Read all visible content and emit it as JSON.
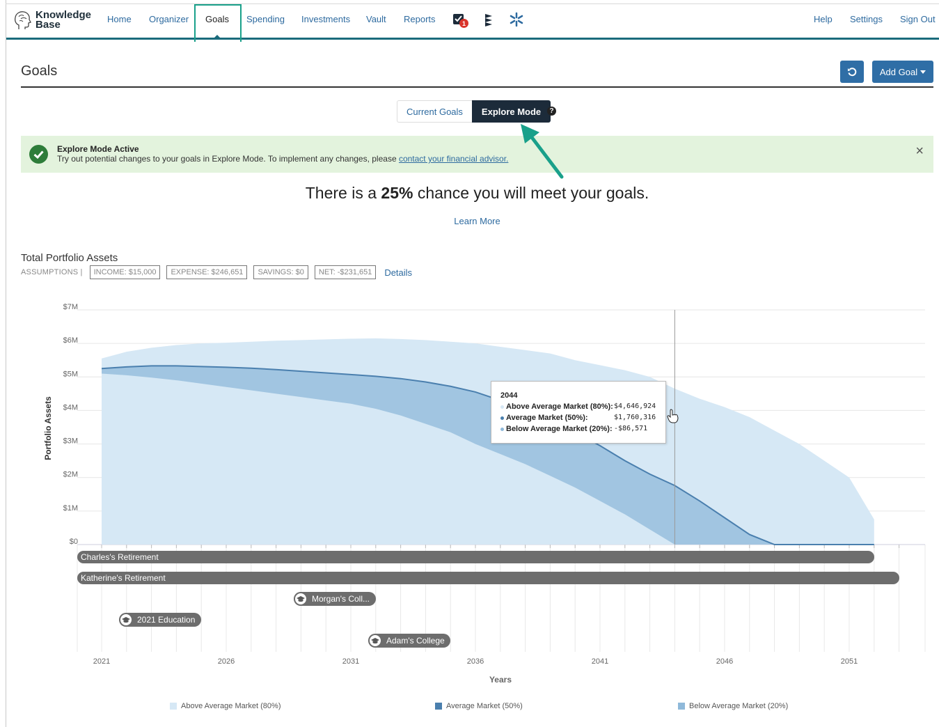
{
  "nav": {
    "brand_line1": "Knowledge",
    "brand_line2": "Base",
    "links": [
      "Home",
      "Organizer",
      "Goals",
      "Spending",
      "Investments",
      "Vault",
      "Reports"
    ],
    "right_links": [
      "Help",
      "Settings",
      "Sign Out"
    ],
    "notification_count": "1",
    "accent_color": "#1a6b7c",
    "active_color": "#19a08a"
  },
  "header": {
    "title": "Goals",
    "add_goal_label": "Add Goal"
  },
  "toggle": {
    "current_goals": "Current Goals",
    "explore_mode": "Explore Mode",
    "help": "?"
  },
  "alert": {
    "title": "Explore Mode Active",
    "text": "Try out potential changes to your goals in Explore Mode. To implement any changes, please ",
    "link": "contact your financial advisor.",
    "close": "×"
  },
  "chance": {
    "prefix": "There is a ",
    "percent": "25%",
    "suffix": " chance you will meet your goals."
  },
  "learn_more": "Learn More",
  "portfolio": {
    "title": "Total Portfolio Assets",
    "assumptions_label": "ASSUMPTIONS |",
    "income": "INCOME: $15,000",
    "expense": "EXPENSE: $246,651",
    "savings": "SAVINGS: $0",
    "net": "NET: -$231,651",
    "details": "Details"
  },
  "tooltip": {
    "year": "2044",
    "rows": [
      {
        "name": "Above Average Market (80%):",
        "value": "$4,646,924"
      },
      {
        "name": "Average Market (50%):",
        "value": "$1,760,316"
      },
      {
        "name": "Below Average Market (20%):",
        "value": "-$86,571"
      }
    ]
  },
  "goals": {
    "charles": "Charles's Retirement",
    "katherine": "Katherine's Retirement",
    "morgan": "Morgan's Coll...",
    "education": "2021 Education",
    "adam": "Adam's College"
  },
  "legend": {
    "above": "Above Average Market (80%)",
    "avg": "Average Market (50%)",
    "below": "Below Average Market (20%)"
  },
  "chart_data": {
    "type": "area",
    "title": "",
    "xlabel": "Years",
    "ylabel": "Portfolio Assets",
    "ylim": [
      0,
      7000000
    ],
    "xlim": [
      2021,
      2053
    ],
    "y_tick_labels": [
      "$0",
      "$1M",
      "$2M",
      "$3M",
      "$4M",
      "$5M",
      "$6M",
      "$7M"
    ],
    "y_ticks": [
      0,
      1000000,
      2000000,
      3000000,
      4000000,
      5000000,
      6000000,
      7000000
    ],
    "x_tick_labels": [
      "2021",
      "2026",
      "2031",
      "2036",
      "2041",
      "2046",
      "2051"
    ],
    "x_ticks": [
      2021,
      2026,
      2031,
      2036,
      2041,
      2046,
      2051
    ],
    "x": [
      2021,
      2022,
      2023,
      2024,
      2025,
      2026,
      2027,
      2028,
      2029,
      2030,
      2031,
      2032,
      2033,
      2034,
      2035,
      2036,
      2037,
      2038,
      2039,
      2040,
      2041,
      2042,
      2043,
      2044,
      2045,
      2046,
      2047,
      2048,
      2049,
      2050,
      2051,
      2052
    ],
    "series": [
      {
        "name": "Above Average Market (80%)",
        "color": "#d6e8f5",
        "values": [
          5.55,
          5.75,
          5.87,
          5.95,
          6.0,
          6.02,
          6.05,
          6.08,
          6.1,
          6.12,
          6.14,
          6.15,
          6.13,
          6.1,
          6.05,
          6.0,
          5.9,
          5.8,
          5.7,
          5.5,
          5.35,
          5.2,
          5.0,
          4.65,
          4.35,
          4.1,
          3.8,
          3.4,
          3.0,
          2.5,
          2.0,
          0.75
        ]
      },
      {
        "name": "Average Market (50%)",
        "color": "#4a7fae",
        "values": [
          5.25,
          5.3,
          5.33,
          5.33,
          5.31,
          5.29,
          5.26,
          5.22,
          5.17,
          5.12,
          5.07,
          5.02,
          4.95,
          4.85,
          4.72,
          4.55,
          4.3,
          4.05,
          3.75,
          3.35,
          2.95,
          2.5,
          2.1,
          1.76,
          1.3,
          0.8,
          0.3,
          0.0,
          0.0,
          0.0,
          0.0,
          0.0
        ]
      },
      {
        "name": "Below Average Market (20%)",
        "color": "#8fb9da",
        "values": [
          5.1,
          5.05,
          4.98,
          4.9,
          4.8,
          4.7,
          4.6,
          4.5,
          4.4,
          4.3,
          4.2,
          4.05,
          3.85,
          3.6,
          3.35,
          3.0,
          2.7,
          2.4,
          2.05,
          1.7,
          1.3,
          0.9,
          0.45,
          0.0,
          0.0,
          0.0,
          0.0,
          0.0,
          0.0,
          0.0,
          0.0,
          0.0
        ]
      }
    ],
    "band_low": [
      5.1,
      5.05,
      4.98,
      4.9,
      4.8,
      4.7,
      4.6,
      4.5,
      4.4,
      4.3,
      4.2,
      4.05,
      3.85,
      3.6,
      3.35,
      3.0,
      2.7,
      2.4,
      2.05,
      1.7,
      1.3,
      0.9,
      0.45,
      0.0,
      0.0,
      0.0,
      0.0,
      0.0,
      0.0,
      0.0,
      0.0,
      0.0
    ],
    "grid": true,
    "legend": "bottom"
  }
}
